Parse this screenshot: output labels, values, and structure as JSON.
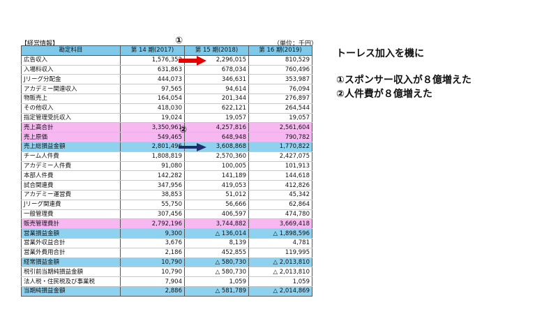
{
  "table": {
    "label": "【経営情報】",
    "unit": "（単位：千円）",
    "headers": [
      "勘定科目",
      "第 14 期(2017)",
      "第 15 期(2018)",
      "第 16 期(2019)"
    ],
    "rows": [
      {
        "label": "広告収入",
        "v": [
          "1,576,352",
          "2,296,015",
          "810,529"
        ],
        "style": ""
      },
      {
        "label": "入場料収入",
        "v": [
          "631,863",
          "678,034",
          "760,496"
        ],
        "style": ""
      },
      {
        "label": "Jリーグ分配金",
        "v": [
          "444,073",
          "346,631",
          "353,987"
        ],
        "style": ""
      },
      {
        "label": "アカデミー関連収入",
        "v": [
          "97,565",
          "94,614",
          "76,094"
        ],
        "style": ""
      },
      {
        "label": "物販売上",
        "v": [
          "164,054",
          "201,344",
          "276,897"
        ],
        "style": ""
      },
      {
        "label": "その他収入",
        "v": [
          "418,030",
          "622,121",
          "264,544"
        ],
        "style": ""
      },
      {
        "label": "指定管理受託収入",
        "v": [
          "19,024",
          "19,057",
          "19,057"
        ],
        "style": ""
      },
      {
        "label": "売上高合計",
        "v": [
          "3,350,961",
          "4,257,816",
          "2,561,604"
        ],
        "style": "pink"
      },
      {
        "label": "売上原価",
        "v": [
          "549,465",
          "648,948",
          "790,782"
        ],
        "style": "pink"
      },
      {
        "label": "売上総損益金額",
        "v": [
          "2,801,496",
          "3,608,868",
          "1,770,822"
        ],
        "style": "blue"
      },
      {
        "label": "チーム人件費",
        "v": [
          "1,808,819",
          "2,570,360",
          "2,427,075"
        ],
        "style": ""
      },
      {
        "label": "アカデミー人件費",
        "v": [
          "91,080",
          "100,005",
          "101,913"
        ],
        "style": ""
      },
      {
        "label": "本部人件費",
        "v": [
          "142,282",
          "141,189",
          "144,618"
        ],
        "style": ""
      },
      {
        "label": "試合関連費",
        "v": [
          "347,956",
          "419,053",
          "412,826"
        ],
        "style": ""
      },
      {
        "label": "アカデミー運営費",
        "v": [
          "38,853",
          "51,012",
          "45,342"
        ],
        "style": ""
      },
      {
        "label": "Jリーグ関連費",
        "v": [
          "55,750",
          "56,666",
          "62,864"
        ],
        "style": ""
      },
      {
        "label": "一般管理費",
        "v": [
          "307,456",
          "406,597",
          "474,780"
        ],
        "style": ""
      },
      {
        "label": "販売管理費計",
        "v": [
          "2,792,196",
          "3,744,882",
          "3,669,418"
        ],
        "style": "pink"
      },
      {
        "label": "営業損益金額",
        "v": [
          "9,300",
          "△ 136,014",
          "△ 1,898,596"
        ],
        "style": "blue"
      },
      {
        "label": "営業外収益合計",
        "v": [
          "3,676",
          "8,139",
          "4,781"
        ],
        "style": ""
      },
      {
        "label": "営業外費用合計",
        "v": [
          "2,186",
          "452,855",
          "119,995"
        ],
        "style": ""
      },
      {
        "label": "経常損益金額",
        "v": [
          "10,790",
          "△ 580,730",
          "△ 2,013,810"
        ],
        "style": "blue"
      },
      {
        "label": "税引前当期純損益金額",
        "v": [
          "10,790",
          "△ 580,730",
          "△ 2,013,810"
        ],
        "style": ""
      },
      {
        "label": "法人税・住民税及び事業税",
        "v": [
          "7,904",
          "1,059",
          "1,059"
        ],
        "style": ""
      },
      {
        "label": "当期純損益金額",
        "v": [
          "2,886",
          "△ 581,789",
          "△ 2,014,869"
        ],
        "style": "blue last"
      }
    ]
  },
  "markers": {
    "one": "①",
    "two": "②"
  },
  "arrows": {
    "red_color": "#e60000",
    "navy_color": "#1f2f6b"
  },
  "panel": {
    "title": "トーレス加入を機に",
    "point1": "①スポンサー収入が８億増えた",
    "point2": "②人件費が８億増えた"
  }
}
